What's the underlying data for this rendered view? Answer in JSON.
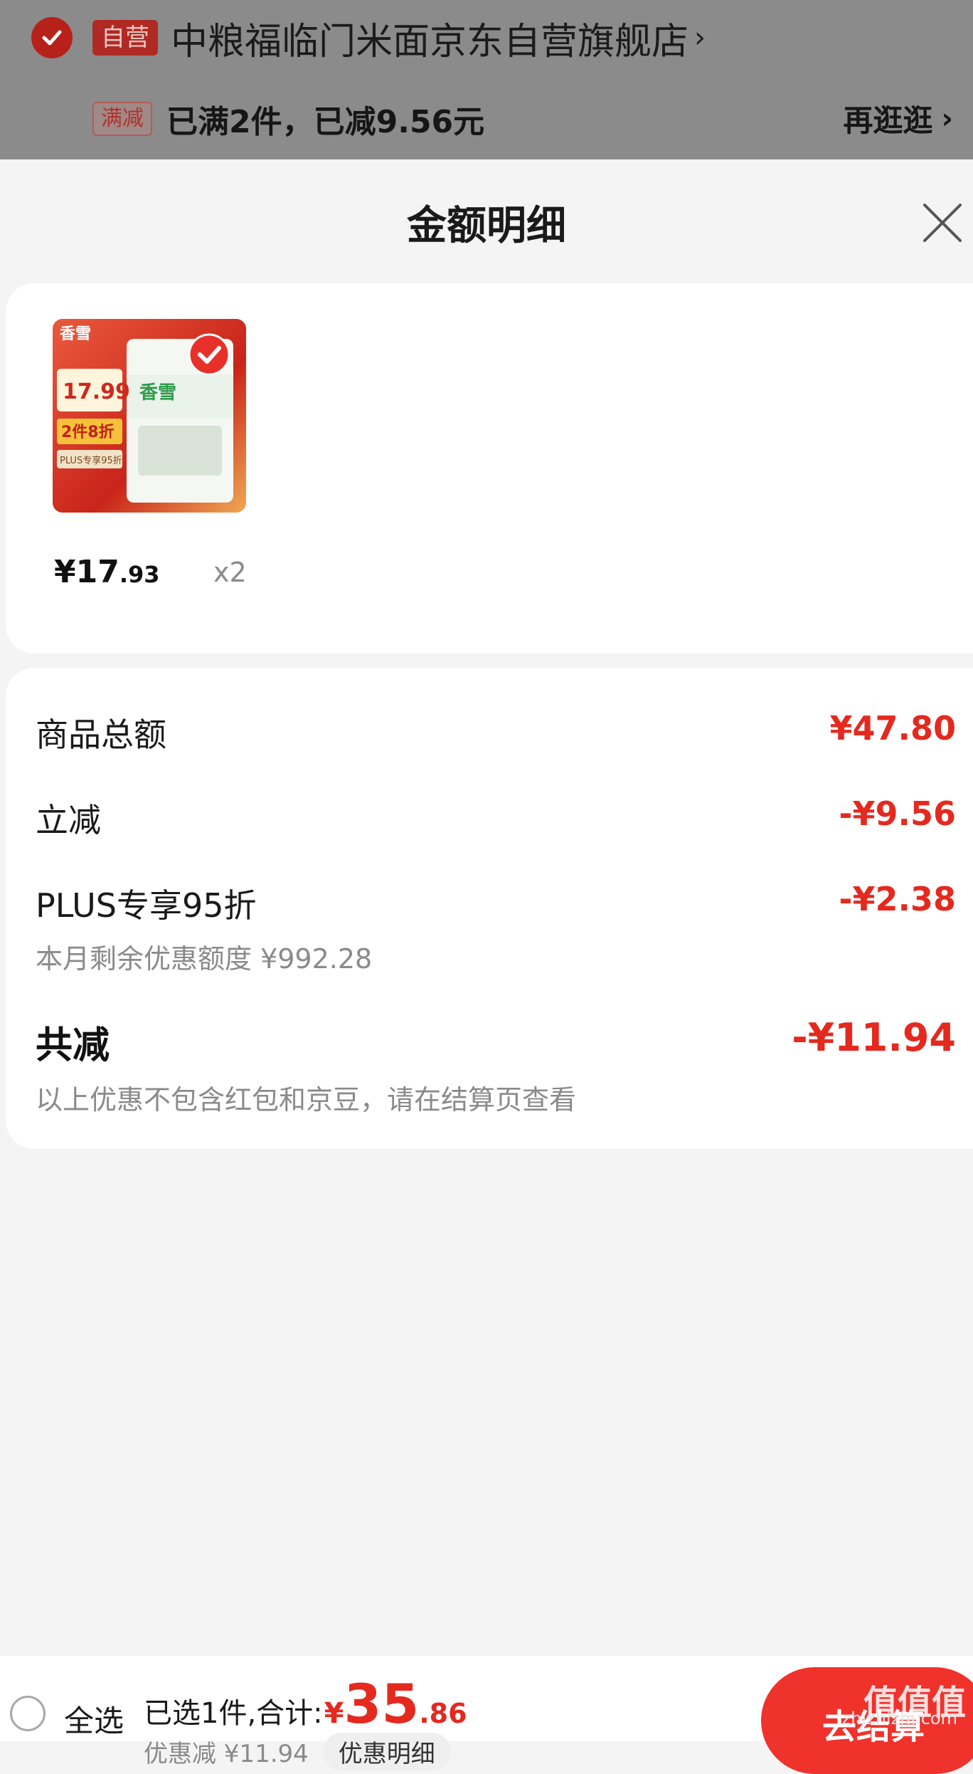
{
  "store": {
    "self_badge": "自营",
    "name": "中粮福临门米面京东自营旗舰店",
    "arrow": "›",
    "promo_badge": "满减",
    "promo_text": "已满2件，已减9.56元",
    "browse_label": "再逛逛",
    "browse_arrow": "›"
  },
  "sheet": {
    "title": "金额明细",
    "close_icon": "close-icon"
  },
  "product": {
    "image_brand": "香雪",
    "image_price": "17.99",
    "image_promo": "2件8折",
    "image_plus": "PLUS专享95折",
    "price_yen_int": "¥17",
    "price_dec": ".93",
    "qty": "x2"
  },
  "details": {
    "rows": [
      {
        "label": "商品总额",
        "value": "¥47.80"
      },
      {
        "label": "立减",
        "value": "-¥9.56"
      },
      {
        "label": "PLUS专享95折",
        "value": "-¥2.38"
      }
    ],
    "plus_sub": "本月剩余优惠额度 ¥992.28",
    "total_label": "共减",
    "total_value": "-¥11.94",
    "note": "以上优惠不包含红包和京豆，请在结算页查看"
  },
  "bottom": {
    "select_all": "全选",
    "sum_text": "已选1件,合计:",
    "sum_yen": "¥",
    "sum_int": "35",
    "sum_dec": ".86",
    "discount_text": "优惠减 ¥11.94",
    "discount_detail": "优惠明细",
    "checkout": "去结算",
    "watermark": "值值值",
    "watermark_small": "zhizhizhi.com"
  },
  "colors": {
    "accent": "#e4291f",
    "overlay": "#8b8b8b",
    "background": "#f4f4f4"
  }
}
